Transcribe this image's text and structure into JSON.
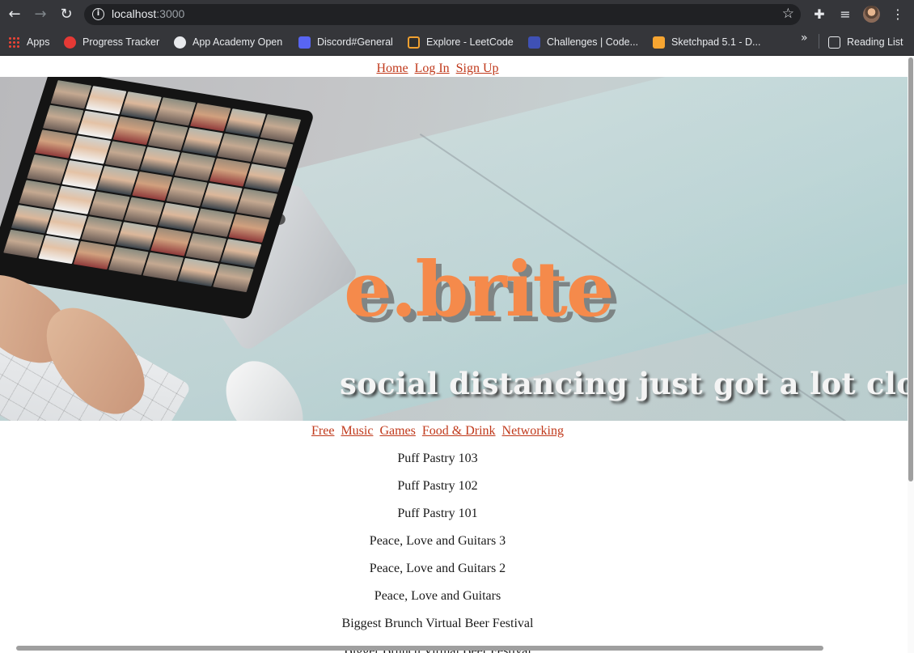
{
  "browser": {
    "url_host": "localhost",
    "url_port": ":3000",
    "bookmarks": [
      {
        "label": "Apps",
        "icon": "apps-grid-icon"
      },
      {
        "label": "Progress Tracker",
        "icon": "progress-tracker-icon"
      },
      {
        "label": "App Academy Open",
        "icon": "app-academy-icon"
      },
      {
        "label": "Discord#General",
        "icon": "discord-icon"
      },
      {
        "label": "Explore - LeetCode",
        "icon": "leetcode-icon"
      },
      {
        "label": "Challenges | Code...",
        "icon": "codewars-icon"
      },
      {
        "label": "Sketchpad 5.1 - D...",
        "icon": "sketchpad-icon"
      }
    ],
    "reading_list": "Reading List",
    "overflow_glyph": "»"
  },
  "site": {
    "nav": {
      "home": "Home",
      "login": "Log In",
      "signup": "Sign Up"
    },
    "hero": {
      "brand": "e.brite",
      "tagline": "social distancing just got a lot closer."
    },
    "categories": [
      "Free",
      "Music",
      "Games",
      "Food & Drink",
      "Networking"
    ],
    "events": [
      "Puff Pastry 103",
      "Puff Pastry 102",
      "Puff Pastry 101",
      "Peace, Love and Guitars 3",
      "Peace, Love and Guitars 2",
      "Peace, Love and Guitars",
      "Biggest Brunch Virtual Beer Festival",
      "Bigger Brunch Virtual Beer Festival"
    ]
  },
  "colors": {
    "link": "#c0391b",
    "brand": "#f58a4b",
    "chrome": "#35363a"
  }
}
